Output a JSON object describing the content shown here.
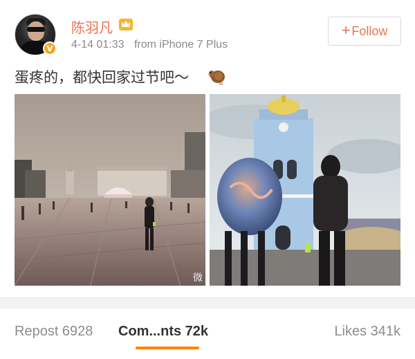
{
  "user": {
    "name": "陈羽凡",
    "verified_badge": "V",
    "timestamp": "4-14 01:33",
    "source": "from iPhone 7 Plus"
  },
  "follow_button": {
    "label": "Follow",
    "plus": "+"
  },
  "post": {
    "text": "蛋疼的，都快回家过节吧～"
  },
  "photos": {
    "watermark": "微"
  },
  "tabs": [
    {
      "label": "Repost 6928"
    },
    {
      "label": "Com...nts 72k"
    },
    {
      "label": "Likes 341k"
    }
  ],
  "colors": {
    "accent": "#eb7350",
    "tab_underline": "#ff8200",
    "verified": "#f5a623"
  },
  "icons": [
    "crown-icon",
    "turkey-emoji-icon",
    "verified-badge-icon",
    "weibo-watermark-icon"
  ]
}
